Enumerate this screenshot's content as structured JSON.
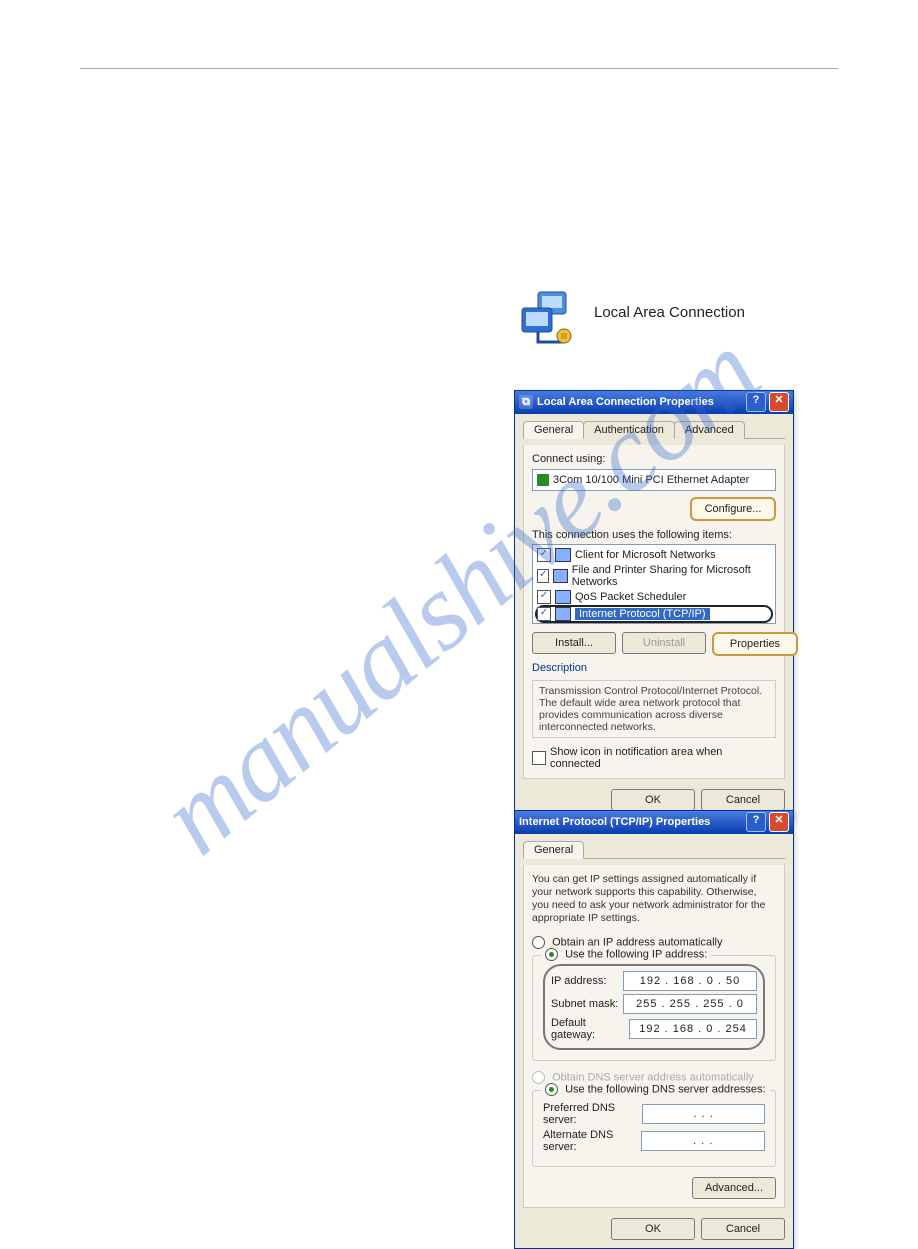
{
  "watermark": "manualshive.com",
  "lan_icon_label": "Local Area Connection",
  "dlg1": {
    "title": "Local Area Connection Properties",
    "tabs": {
      "general": "General",
      "auth": "Authentication",
      "adv": "Advanced"
    },
    "connect_using_label": "Connect using:",
    "adapter": "3Com 10/100 Mini PCI Ethernet Adapter",
    "configure_btn": "Configure...",
    "items_label": "This connection uses the following items:",
    "items": [
      "Client for Microsoft Networks",
      "File and Printer Sharing for Microsoft Networks",
      "QoS Packet Scheduler",
      "Internet Protocol (TCP/IP)"
    ],
    "install_btn": "Install...",
    "uninstall_btn": "Uninstall",
    "properties_btn": "Properties",
    "desc_label": "Description",
    "desc_text": "Transmission Control Protocol/Internet Protocol. The default wide area network protocol that provides communication across diverse interconnected networks.",
    "show_icon": "Show icon in notification area when connected",
    "ok": "OK",
    "cancel": "Cancel"
  },
  "dlg2": {
    "title": "Internet Protocol (TCP/IP) Properties",
    "tab_general": "General",
    "intro": "You can get IP settings assigned automatically if your network supports this capability. Otherwise, you need to ask your network administrator for the appropriate IP settings.",
    "ip_auto": "Obtain an IP address automatically",
    "ip_manual": "Use the following IP address:",
    "ip_label": "IP address:",
    "ip_value": "192 . 168 .   0  .  50",
    "mask_label": "Subnet mask:",
    "mask_value": "255 . 255 . 255 .  0",
    "gw_label": "Default gateway:",
    "gw_value": "192 . 168 .   0  . 254",
    "dns_auto": "Obtain DNS server address automatically",
    "dns_manual": "Use the following DNS server addresses:",
    "pref_dns_label": "Preferred DNS server:",
    "pref_dns_value": " .       .       . ",
    "alt_dns_label": "Alternate DNS server:",
    "alt_dns_value": " .       .       . ",
    "advanced_btn": "Advanced...",
    "ok": "OK",
    "cancel": "Cancel"
  }
}
